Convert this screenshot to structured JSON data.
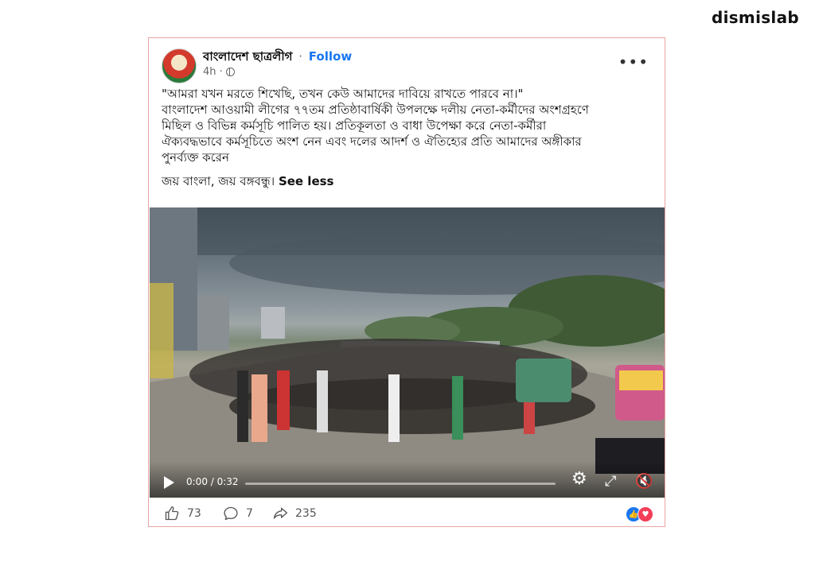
{
  "brand": {
    "watermark": "dismislab"
  },
  "post": {
    "page_name": "বাংলাদেশ ছাত্রলীগ",
    "separator": "·",
    "follow_label": "Follow",
    "time": "4h ·",
    "audience_icon": "globe-icon",
    "more_icon": "•••",
    "text_lines": [
      "\"আমরা যখন মরতে শিখেছি, তখন কেউ আমাদের দাবিয়ে রাখতে পারবে না।\"",
      "বাংলাদেশ আওয়ামী লীগের ৭৭তম প্রতিষ্ঠাবার্ষিকী উপলক্ষে দলীয় নেতা-কর্মীদের অংশগ্রহণে",
      "মিছিল ও বিভিন্ন কর্মসূচি পালিত হয়। প্রতিকূলতা ও বাধা উপেক্ষা করে নেতা-কর্মীরা",
      "ঐক্যবদ্ধভাবে কর্মসূচিতে অংশ নেন এবং দলের আদর্শ ও ঐতিহ্যের প্রতি আমাদের  অঙ্গীকার",
      "পুনর্ব্যক্ত করেন"
    ],
    "closing_line": "জয় বাংলা, জয় বঙ্গবন্ধু।",
    "see_less_label": "See less"
  },
  "video": {
    "time_display": "0:00 / 0:32",
    "progress": 0.0,
    "icons": [
      "play-icon",
      "gear-icon",
      "fullscreen-icon",
      "mute-icon"
    ]
  },
  "footer": {
    "likes": "73",
    "comments": "7",
    "shares": "235",
    "reaction_icons": [
      "like-reaction-icon",
      "love-reaction-icon"
    ]
  },
  "colors": {
    "accent": "#1877f2",
    "border": "#e7a4a4",
    "love": "#f33e58"
  }
}
